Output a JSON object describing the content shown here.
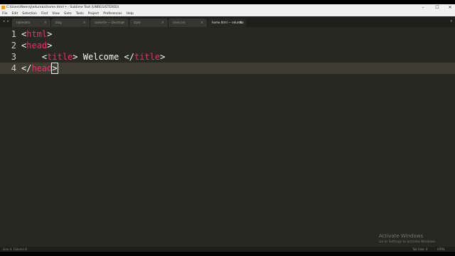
{
  "window": {
    "title": "C:\\Users\\Neeraj\\edureka\\home.html • - Sublime Text (UNREGISTERED)",
    "controls": {
      "minimize": "–",
      "maximize": "☐",
      "close": "✕"
    }
  },
  "menu": [
    "File",
    "Edit",
    "Selection",
    "Find",
    "View",
    "Goto",
    "Tools",
    "Project",
    "Preferences",
    "Help"
  ],
  "tabs": [
    {
      "label": "tabledata"
    },
    {
      "label": "blog"
    },
    {
      "label": "lastwrite — Desktop"
    },
    {
      "label": "style"
    },
    {
      "label": "class.css"
    },
    {
      "label": "home.html — edureka"
    }
  ],
  "tabbar": {
    "arrows": "◂ ▸",
    "menu_icon": "▾"
  },
  "editor": {
    "lines": [
      {
        "num": "1",
        "indent": "",
        "open": "<",
        "slash": "",
        "tag": "html",
        "close": ">",
        "rest": ""
      },
      {
        "num": "2",
        "indent": "",
        "open": "<",
        "slash": "",
        "tag": "head",
        "close": ">",
        "rest": ""
      },
      {
        "num": "3",
        "indent": "    ",
        "open": "<",
        "slash": "",
        "tag": "title",
        "close": ">",
        "text": " Welcome ",
        "end_open": "</",
        "end_tag": "title",
        "end_close": ">"
      },
      {
        "num": "4",
        "indent": "",
        "open": "</",
        "slash": "",
        "tag": "head",
        "close": ">",
        "rest": ""
      }
    ],
    "current_line": 4
  },
  "watermark": {
    "title": "Activate Windows",
    "subtitle": "Go to Settings to activate Windows."
  },
  "status": {
    "left": "Line 4, Column 8",
    "middle": "Tab Size: 4",
    "right": "HTML"
  }
}
